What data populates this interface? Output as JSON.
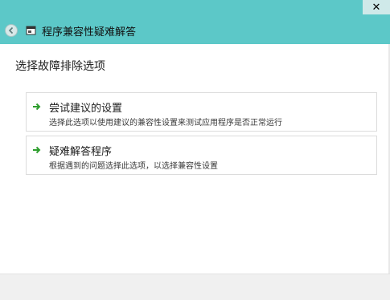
{
  "window": {
    "title": "程序兼容性疑难解答",
    "close_glyph": "✕",
    "accent_color": "#5cc8c8"
  },
  "page": {
    "heading": "选择故障排除选项"
  },
  "options": [
    {
      "title": "尝试建议的设置",
      "description": "选择此选项以使用建议的兼容性设置来测试应用程序是否正常运行",
      "icon": "green-arrow-icon"
    },
    {
      "title": "疑难解答程序",
      "description": "根据遇到的问题选择此选项，以选择兼容性设置",
      "icon": "green-arrow-icon"
    }
  ],
  "icons": {
    "back": "back-arrow-icon",
    "app": "compatibility-app-icon"
  }
}
